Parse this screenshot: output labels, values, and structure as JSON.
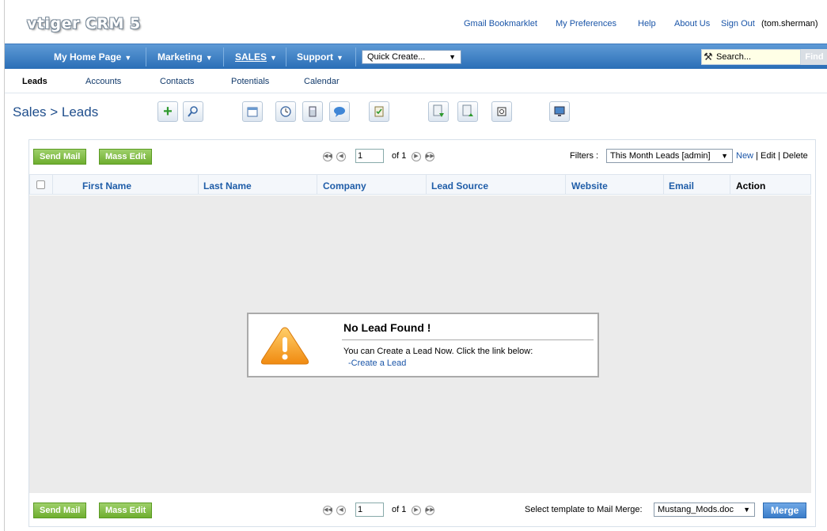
{
  "header": {
    "logo": "vtiger CRM 5",
    "links": {
      "gmail": "Gmail Bookmarklet",
      "prefs": "My Preferences",
      "help": "Help",
      "about": "About Us",
      "signout": "Sign Out",
      "user": "(tom.sherman)"
    }
  },
  "menu": {
    "items": [
      {
        "label": "My Home Page"
      },
      {
        "label": "Marketing"
      },
      {
        "label": "SALES"
      },
      {
        "label": "Support"
      }
    ],
    "quick_create": "Quick Create...",
    "search_placeholder": "Search...",
    "find_label": "Find"
  },
  "submenu": [
    "Leads",
    "Accounts",
    "Contacts",
    "Potentials",
    "Calendar"
  ],
  "page": {
    "breadcrumb": "Sales > Leads"
  },
  "toolbar": [
    "add-icon",
    "search-icon",
    "calendar-icon",
    "clock-icon",
    "calculator-icon",
    "chat-icon",
    "checklist-icon",
    "import-icon",
    "export-icon",
    "find-duplicates-icon",
    "webmail-icon"
  ],
  "list": {
    "send_mail": "Send Mail",
    "mass_edit": "Mass Edit",
    "page_value": "1",
    "page_of": "of 1",
    "filters_label": "Filters :",
    "filter_value": "This Month Leads [admin]",
    "filter_new": "New",
    "filter_edit": "Edit",
    "filter_delete": "Delete",
    "sep": "|",
    "columns": [
      "First Name",
      "Last Name",
      "Company",
      "Lead Source",
      "Website",
      "Email",
      "Action"
    ],
    "empty_title": "No Lead Found !",
    "empty_msg": "You can Create a Lead Now. Click the link below:",
    "empty_link": "-Create a Lead",
    "merge_label": "Select template to Mail Merge:",
    "merge_template": "Mustang_Mods.doc",
    "merge_button": "Merge"
  }
}
